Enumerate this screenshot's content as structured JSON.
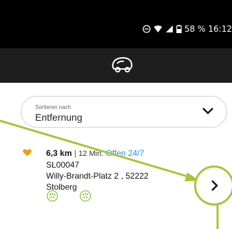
{
  "status_bar": {
    "battery_percent": "58 %",
    "time": "16:12"
  },
  "sort": {
    "caption": "Sortieren nach",
    "value": "Entfernung"
  },
  "station": {
    "distance": "6,3 km",
    "separator": "|",
    "drive_time": "12 Min.",
    "availability": "Offen 24/7",
    "id": "SL00047",
    "address_line": "Willy-Brandt-Platz 2 , 52222",
    "city": "Stolberg"
  },
  "colors": {
    "accent": "#a8c436",
    "favorite": "#f39c12",
    "open_status": "#1e90ff",
    "connector_icon": "#8cc63f"
  },
  "icons": {
    "logo": "electric-car-icon",
    "sort_chevron": "chevron-down-icon",
    "favorite": "heart-icon",
    "detail": "chevron-right-icon",
    "connector": "plug-type2-icon"
  }
}
